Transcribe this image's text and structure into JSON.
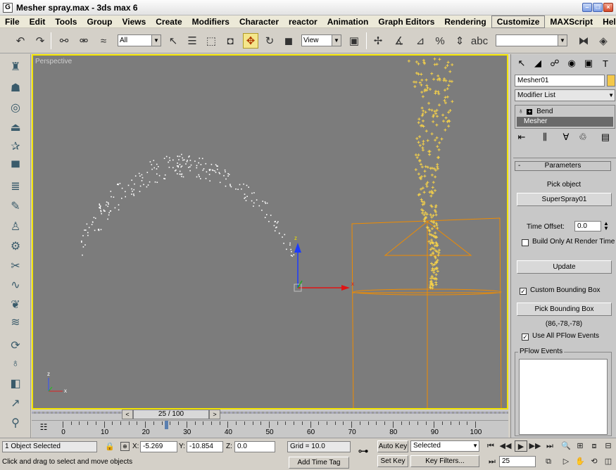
{
  "window": {
    "title": "Mesher spray.max - 3ds max 6",
    "app_icon": "G"
  },
  "menu": [
    "File",
    "Edit",
    "Tools",
    "Group",
    "Views",
    "Create",
    "Modifiers",
    "Character",
    "reactor",
    "Animation",
    "Graph Editors",
    "Rendering",
    "Customize",
    "MAXScript",
    "Help"
  ],
  "toolbar": {
    "selection_filter": "All",
    "ref_coord": "View",
    "named_selection": ""
  },
  "viewport": {
    "label": "Perspective",
    "axis_z": "z",
    "axis_x": "x",
    "axis_y": "y"
  },
  "command_panel": {
    "object_name": "Mesher01",
    "modifier_list_label": "Modifier List",
    "stack": [
      "Bend",
      "Mesher"
    ],
    "rollout_title": "Parameters",
    "rollout_toggle": "-",
    "pick_object_label": "Pick object",
    "pick_object_value": "SuperSpray01",
    "time_offset_label": "Time Offset:",
    "time_offset_value": "0.0",
    "build_only_label": "Build Only At Render Time",
    "update_label": "Update",
    "custom_bbox_label": "Custom Bounding Box",
    "pick_bbox_label": "Pick Bounding Box",
    "bbox_values": "(86,-78,-78)",
    "use_all_pflow_label": "Use All PFlow Events",
    "pflow_events_label": "PFlow Events"
  },
  "timeline": {
    "frame_display": "25 / 100",
    "ticks": [
      "0",
      "10",
      "20",
      "30",
      "40",
      "50",
      "60",
      "70",
      "80",
      "90",
      "100"
    ],
    "current_frame": 25,
    "total_frames": 100
  },
  "status": {
    "selection": "1 Object Selected",
    "prompt": "Click and drag to select and move objects",
    "x_label": "X:",
    "x_value": "-5.269",
    "y_label": "Y:",
    "y_value": "-10.854",
    "z_label": "Z:",
    "z_value": "0.0",
    "grid": "Grid = 10.0",
    "add_time_tag": "Add Time Tag",
    "auto_key": "Auto Key",
    "set_key": "Set Key",
    "key_mode": "Selected",
    "key_filters": "Key Filters...",
    "frame_field": "25"
  },
  "colors": {
    "viewport_bg": "#7c7c7c",
    "active_border": "#f2e400",
    "gizmo_orange": "#f08c00",
    "particles_yellow": "#f4d04a",
    "particles_white": "#ffffff"
  }
}
